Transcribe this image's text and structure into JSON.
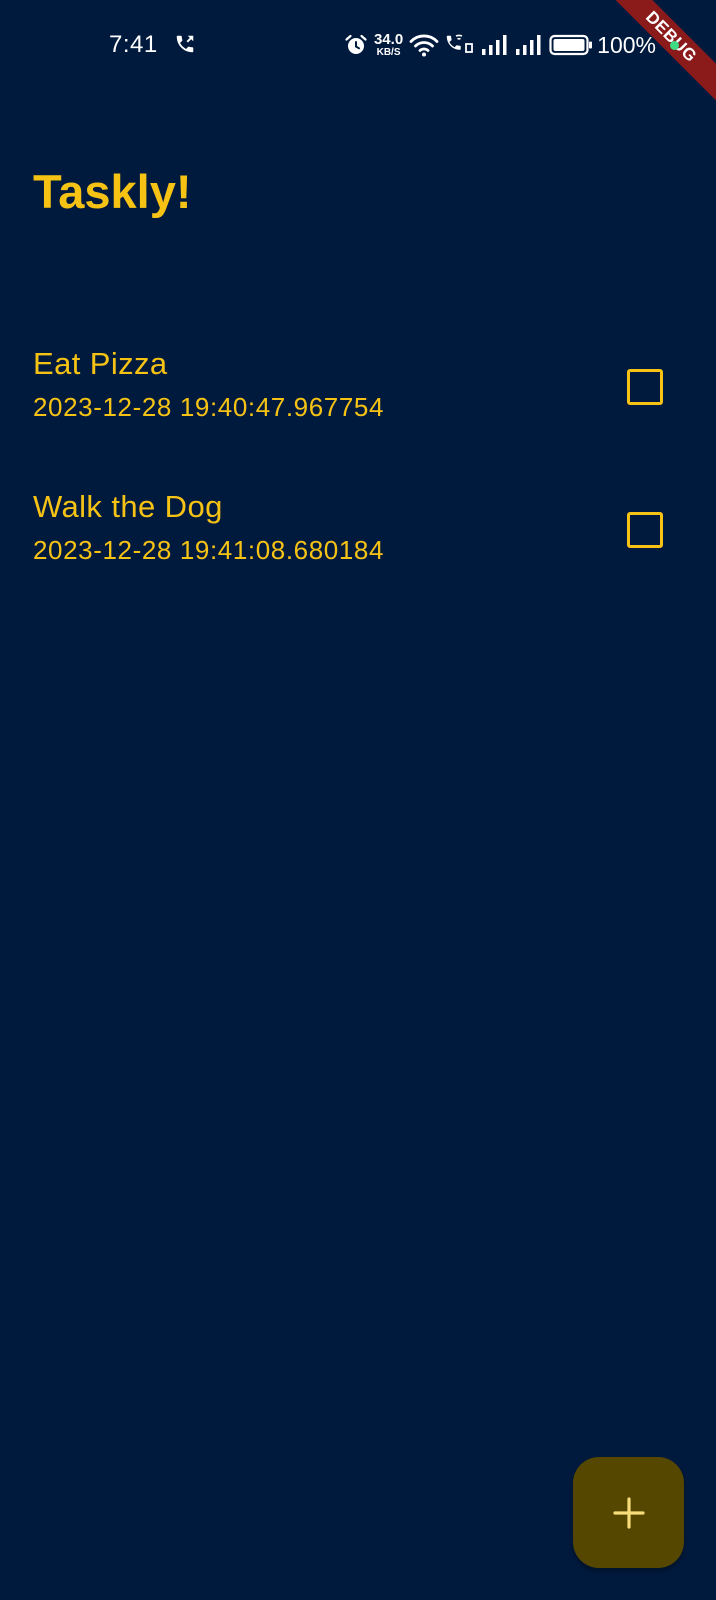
{
  "status_bar": {
    "time": "7:41",
    "net_speed_value": "34.0",
    "net_speed_unit": "KB/S",
    "battery_percent": "100%",
    "icons": [
      "call-icon",
      "alarm-icon",
      "wifi-icon",
      "volte-call-icon",
      "signal-icon",
      "signal-icon",
      "battery-icon"
    ]
  },
  "debug_banner": {
    "label": "DEBUG"
  },
  "app": {
    "title": "Taskly!"
  },
  "tasks": [
    {
      "title": "Eat Pizza",
      "timestamp": "2023-12-28 19:40:47.967754",
      "done": false
    },
    {
      "title": "Walk the Dog",
      "timestamp": "2023-12-28 19:41:08.680184",
      "done": false
    }
  ],
  "fab": {
    "icon": "plus-icon"
  },
  "colors": {
    "background": "#001a3e",
    "accent": "#f6c315",
    "fab_background": "#554600",
    "debug_banner": "#8b1a1a"
  }
}
